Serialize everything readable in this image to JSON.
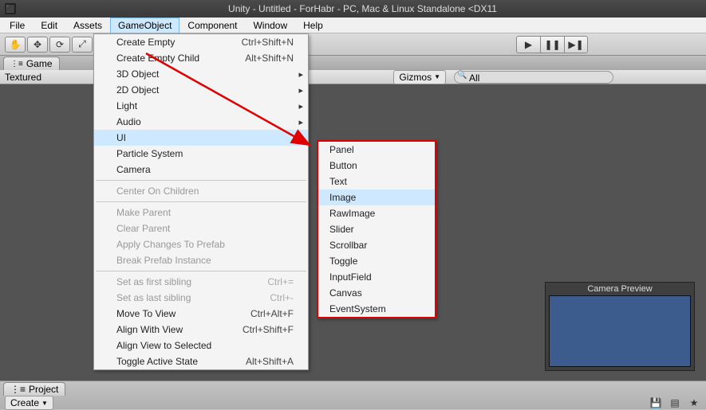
{
  "titlebar": {
    "title": "Unity - Untitled - ForHabr - PC, Mac & Linux Standalone <DX11"
  },
  "menubar": {
    "items": [
      {
        "label": "File"
      },
      {
        "label": "Edit"
      },
      {
        "label": "Assets"
      },
      {
        "label": "GameObject",
        "active": true
      },
      {
        "label": "Component"
      },
      {
        "label": "Window"
      },
      {
        "label": "Help"
      }
    ]
  },
  "tabs": {
    "game": "Game",
    "project": "Project"
  },
  "scene_toolbar": {
    "textured": "Textured",
    "gizmos": "Gizmos",
    "search_value": "All"
  },
  "camera_preview": {
    "title": "Camera Preview"
  },
  "bottom": {
    "create": "Create"
  },
  "gameobject_menu": {
    "create_empty": {
      "label": "Create Empty",
      "shortcut": "Ctrl+Shift+N"
    },
    "create_empty_child": {
      "label": "Create Empty Child",
      "shortcut": "Alt+Shift+N"
    },
    "three_d": "3D Object",
    "two_d": "2D Object",
    "light": "Light",
    "audio": "Audio",
    "ui": "UI",
    "particle": "Particle System",
    "camera": "Camera",
    "center_children": "Center On Children",
    "make_parent": "Make Parent",
    "clear_parent": "Clear Parent",
    "apply_prefab": "Apply Changes To Prefab",
    "break_prefab": "Break Prefab Instance",
    "first_sibling": {
      "label": "Set as first sibling",
      "shortcut": "Ctrl+="
    },
    "last_sibling": {
      "label": "Set as last sibling",
      "shortcut": "Ctrl+-"
    },
    "move_to_view": {
      "label": "Move To View",
      "shortcut": "Ctrl+Alt+F"
    },
    "align_with_view": {
      "label": "Align With View",
      "shortcut": "Ctrl+Shift+F"
    },
    "align_view_sel": "Align View to Selected",
    "toggle_active": {
      "label": "Toggle Active State",
      "shortcut": "Alt+Shift+A"
    }
  },
  "ui_submenu": {
    "panel": "Panel",
    "button": "Button",
    "text": "Text",
    "image": "Image",
    "rawimage": "RawImage",
    "slider": "Slider",
    "scrollbar": "Scrollbar",
    "toggle": "Toggle",
    "inputfield": "InputField",
    "canvas": "Canvas",
    "eventsystem": "EventSystem"
  }
}
